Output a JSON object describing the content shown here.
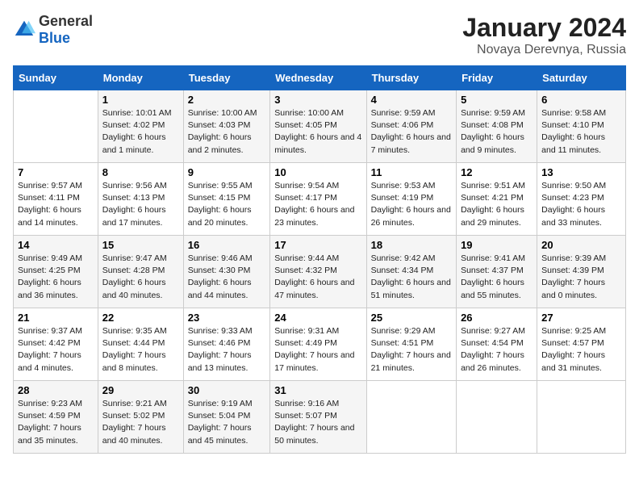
{
  "header": {
    "logo_general": "General",
    "logo_blue": "Blue",
    "title": "January 2024",
    "subtitle": "Novaya Derevnya, Russia"
  },
  "calendar": {
    "weekdays": [
      "Sunday",
      "Monday",
      "Tuesday",
      "Wednesday",
      "Thursday",
      "Friday",
      "Saturday"
    ],
    "weeks": [
      [
        {
          "day": "",
          "sunrise": "",
          "sunset": "",
          "daylight": ""
        },
        {
          "day": "1",
          "sunrise": "Sunrise: 10:01 AM",
          "sunset": "Sunset: 4:02 PM",
          "daylight": "Daylight: 6 hours and 1 minute."
        },
        {
          "day": "2",
          "sunrise": "Sunrise: 10:00 AM",
          "sunset": "Sunset: 4:03 PM",
          "daylight": "Daylight: 6 hours and 2 minutes."
        },
        {
          "day": "3",
          "sunrise": "Sunrise: 10:00 AM",
          "sunset": "Sunset: 4:05 PM",
          "daylight": "Daylight: 6 hours and 4 minutes."
        },
        {
          "day": "4",
          "sunrise": "Sunrise: 9:59 AM",
          "sunset": "Sunset: 4:06 PM",
          "daylight": "Daylight: 6 hours and 7 minutes."
        },
        {
          "day": "5",
          "sunrise": "Sunrise: 9:59 AM",
          "sunset": "Sunset: 4:08 PM",
          "daylight": "Daylight: 6 hours and 9 minutes."
        },
        {
          "day": "6",
          "sunrise": "Sunrise: 9:58 AM",
          "sunset": "Sunset: 4:10 PM",
          "daylight": "Daylight: 6 hours and 11 minutes."
        }
      ],
      [
        {
          "day": "7",
          "sunrise": "Sunrise: 9:57 AM",
          "sunset": "Sunset: 4:11 PM",
          "daylight": "Daylight: 6 hours and 14 minutes."
        },
        {
          "day": "8",
          "sunrise": "Sunrise: 9:56 AM",
          "sunset": "Sunset: 4:13 PM",
          "daylight": "Daylight: 6 hours and 17 minutes."
        },
        {
          "day": "9",
          "sunrise": "Sunrise: 9:55 AM",
          "sunset": "Sunset: 4:15 PM",
          "daylight": "Daylight: 6 hours and 20 minutes."
        },
        {
          "day": "10",
          "sunrise": "Sunrise: 9:54 AM",
          "sunset": "Sunset: 4:17 PM",
          "daylight": "Daylight: 6 hours and 23 minutes."
        },
        {
          "day": "11",
          "sunrise": "Sunrise: 9:53 AM",
          "sunset": "Sunset: 4:19 PM",
          "daylight": "Daylight: 6 hours and 26 minutes."
        },
        {
          "day": "12",
          "sunrise": "Sunrise: 9:51 AM",
          "sunset": "Sunset: 4:21 PM",
          "daylight": "Daylight: 6 hours and 29 minutes."
        },
        {
          "day": "13",
          "sunrise": "Sunrise: 9:50 AM",
          "sunset": "Sunset: 4:23 PM",
          "daylight": "Daylight: 6 hours and 33 minutes."
        }
      ],
      [
        {
          "day": "14",
          "sunrise": "Sunrise: 9:49 AM",
          "sunset": "Sunset: 4:25 PM",
          "daylight": "Daylight: 6 hours and 36 minutes."
        },
        {
          "day": "15",
          "sunrise": "Sunrise: 9:47 AM",
          "sunset": "Sunset: 4:28 PM",
          "daylight": "Daylight: 6 hours and 40 minutes."
        },
        {
          "day": "16",
          "sunrise": "Sunrise: 9:46 AM",
          "sunset": "Sunset: 4:30 PM",
          "daylight": "Daylight: 6 hours and 44 minutes."
        },
        {
          "day": "17",
          "sunrise": "Sunrise: 9:44 AM",
          "sunset": "Sunset: 4:32 PM",
          "daylight": "Daylight: 6 hours and 47 minutes."
        },
        {
          "day": "18",
          "sunrise": "Sunrise: 9:42 AM",
          "sunset": "Sunset: 4:34 PM",
          "daylight": "Daylight: 6 hours and 51 minutes."
        },
        {
          "day": "19",
          "sunrise": "Sunrise: 9:41 AM",
          "sunset": "Sunset: 4:37 PM",
          "daylight": "Daylight: 6 hours and 55 minutes."
        },
        {
          "day": "20",
          "sunrise": "Sunrise: 9:39 AM",
          "sunset": "Sunset: 4:39 PM",
          "daylight": "Daylight: 7 hours and 0 minutes."
        }
      ],
      [
        {
          "day": "21",
          "sunrise": "Sunrise: 9:37 AM",
          "sunset": "Sunset: 4:42 PM",
          "daylight": "Daylight: 7 hours and 4 minutes."
        },
        {
          "day": "22",
          "sunrise": "Sunrise: 9:35 AM",
          "sunset": "Sunset: 4:44 PM",
          "daylight": "Daylight: 7 hours and 8 minutes."
        },
        {
          "day": "23",
          "sunrise": "Sunrise: 9:33 AM",
          "sunset": "Sunset: 4:46 PM",
          "daylight": "Daylight: 7 hours and 13 minutes."
        },
        {
          "day": "24",
          "sunrise": "Sunrise: 9:31 AM",
          "sunset": "Sunset: 4:49 PM",
          "daylight": "Daylight: 7 hours and 17 minutes."
        },
        {
          "day": "25",
          "sunrise": "Sunrise: 9:29 AM",
          "sunset": "Sunset: 4:51 PM",
          "daylight": "Daylight: 7 hours and 21 minutes."
        },
        {
          "day": "26",
          "sunrise": "Sunrise: 9:27 AM",
          "sunset": "Sunset: 4:54 PM",
          "daylight": "Daylight: 7 hours and 26 minutes."
        },
        {
          "day": "27",
          "sunrise": "Sunrise: 9:25 AM",
          "sunset": "Sunset: 4:57 PM",
          "daylight": "Daylight: 7 hours and 31 minutes."
        }
      ],
      [
        {
          "day": "28",
          "sunrise": "Sunrise: 9:23 AM",
          "sunset": "Sunset: 4:59 PM",
          "daylight": "Daylight: 7 hours and 35 minutes."
        },
        {
          "day": "29",
          "sunrise": "Sunrise: 9:21 AM",
          "sunset": "Sunset: 5:02 PM",
          "daylight": "Daylight: 7 hours and 40 minutes."
        },
        {
          "day": "30",
          "sunrise": "Sunrise: 9:19 AM",
          "sunset": "Sunset: 5:04 PM",
          "daylight": "Daylight: 7 hours and 45 minutes."
        },
        {
          "day": "31",
          "sunrise": "Sunrise: 9:16 AM",
          "sunset": "Sunset: 5:07 PM",
          "daylight": "Daylight: 7 hours and 50 minutes."
        },
        {
          "day": "",
          "sunrise": "",
          "sunset": "",
          "daylight": ""
        },
        {
          "day": "",
          "sunrise": "",
          "sunset": "",
          "daylight": ""
        },
        {
          "day": "",
          "sunrise": "",
          "sunset": "",
          "daylight": ""
        }
      ]
    ]
  }
}
